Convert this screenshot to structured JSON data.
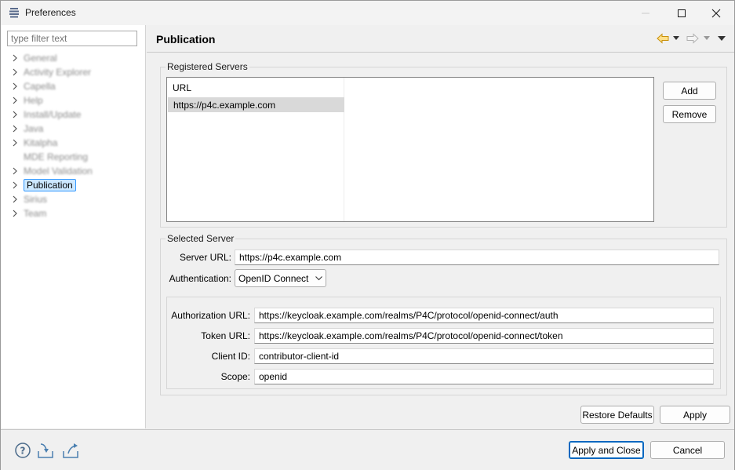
{
  "window": {
    "title": "Preferences"
  },
  "sidebar": {
    "filter_placeholder": "type filter text",
    "items": [
      {
        "label": "General",
        "expandable": true
      },
      {
        "label": "Activity Explorer",
        "expandable": true
      },
      {
        "label": "Capella",
        "expandable": true
      },
      {
        "label": "Help",
        "expandable": true
      },
      {
        "label": "Install/Update",
        "expandable": true
      },
      {
        "label": "Java",
        "expandable": true
      },
      {
        "label": "Kitalpha",
        "expandable": true
      },
      {
        "label": "MDE Reporting",
        "expandable": false
      },
      {
        "label": "Model Validation",
        "expandable": true
      },
      {
        "label": "Publication",
        "expandable": true,
        "selected": true
      },
      {
        "label": "Sirius",
        "expandable": true
      },
      {
        "label": "Team",
        "expandable": true
      }
    ]
  },
  "page": {
    "title": "Publication"
  },
  "registered_servers": {
    "legend": "Registered Servers",
    "column_header": "URL",
    "rows": [
      "https://p4c.example.com"
    ],
    "add_label": "Add",
    "remove_label": "Remove"
  },
  "selected_server": {
    "legend": "Selected Server",
    "server_url_label": "Server URL:",
    "server_url_value": "https://p4c.example.com",
    "authentication_label": "Authentication:",
    "authentication_value": "OpenID Connect",
    "authorization_url_label": "Authorization URL:",
    "authorization_url_value": "https://keycloak.example.com/realms/P4C/protocol/openid-connect/auth",
    "token_url_label": "Token URL:",
    "token_url_value": "https://keycloak.example.com/realms/P4C/protocol/openid-connect/token",
    "client_id_label": "Client ID:",
    "client_id_value": "contributor-client-id",
    "scope_label": "Scope:",
    "scope_value": "openid"
  },
  "page_buttons": {
    "restore_defaults": "Restore Defaults",
    "apply": "Apply"
  },
  "dialog_buttons": {
    "apply_and_close": "Apply and Close",
    "cancel": "Cancel"
  },
  "colors": {
    "selection_bg": "#cce8ff",
    "selection_border": "#3399ff",
    "default_button_border": "#0067c0",
    "nav_back_arrow": "#e0a000"
  },
  "icons": {
    "help": "help-icon",
    "import": "import-icon",
    "export": "export-icon",
    "back": "back-arrow-icon",
    "forward": "forward-arrow-icon"
  }
}
